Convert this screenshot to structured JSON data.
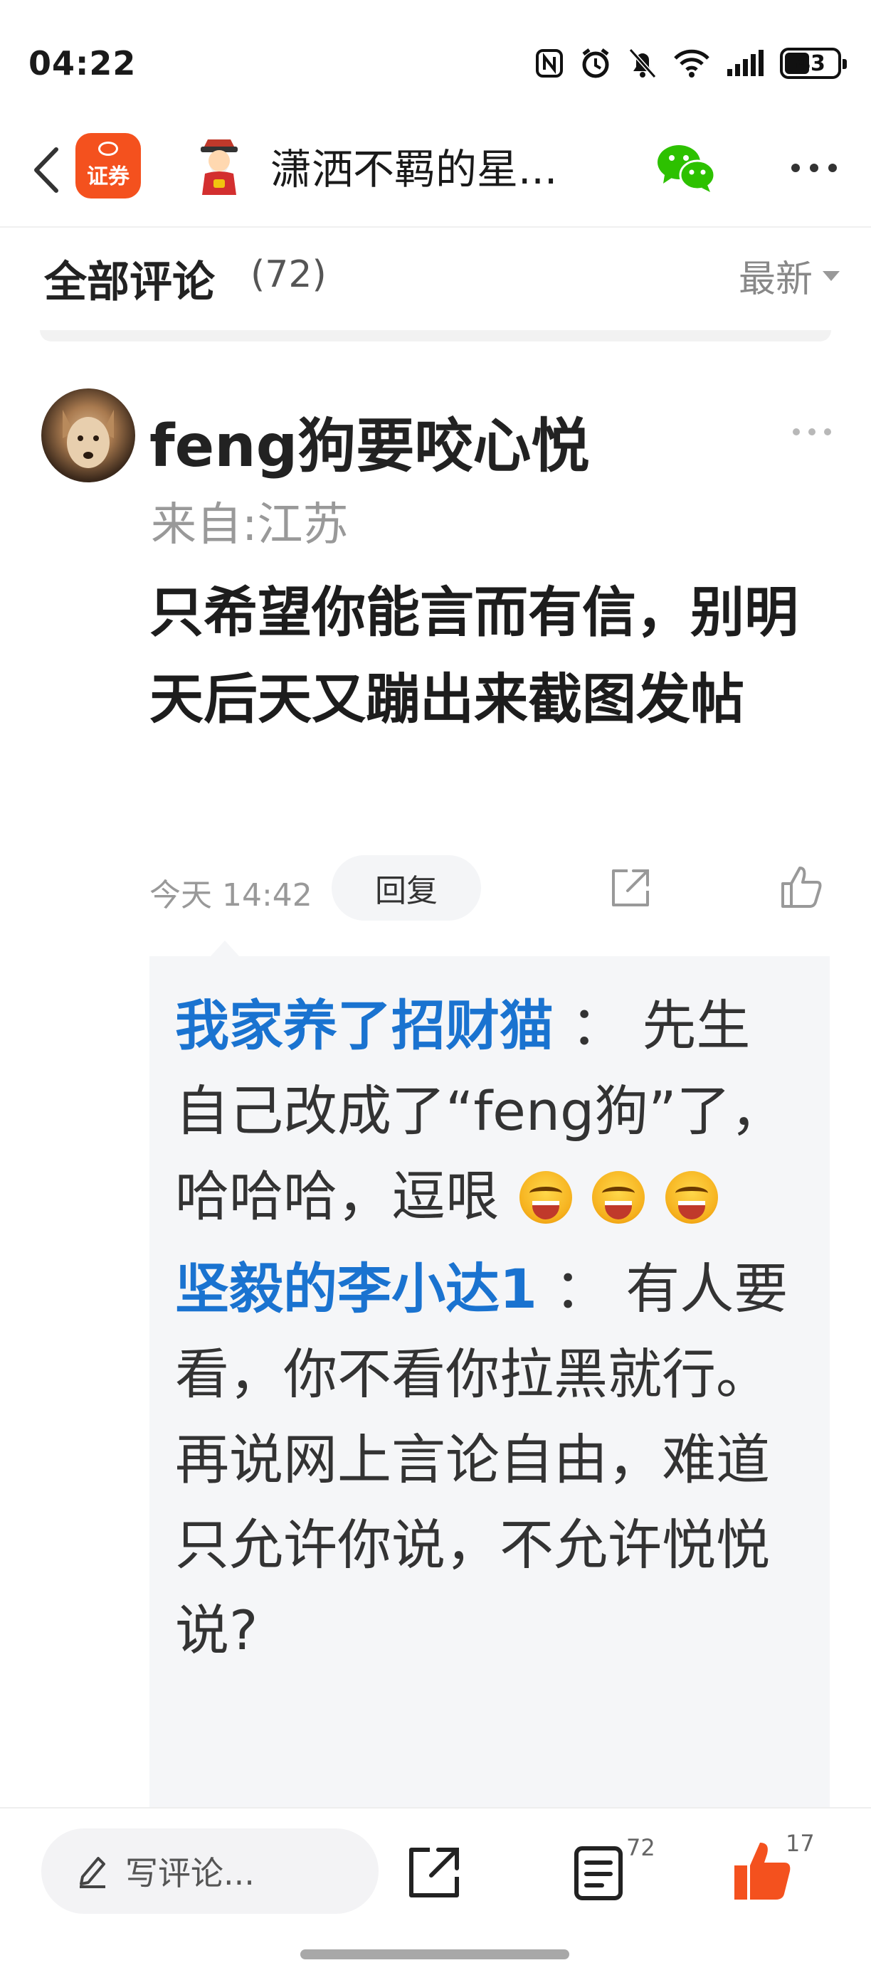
{
  "status_bar": {
    "time": "04:22",
    "battery": 43
  },
  "nav": {
    "app_badge_label": "证券",
    "title": "潇洒不羁的星...",
    "icons": [
      "back-icon",
      "wechat-icon",
      "more-icon"
    ]
  },
  "comments_header": {
    "title": "全部评论",
    "count": "(72)",
    "sort_label": "最新"
  },
  "comment": {
    "author": "feng狗要咬心悦",
    "location": "来自:江苏",
    "body": "只希望你能言而有信，别明天后天又蹦出来截图发帖",
    "time": "今天 14:42",
    "reply_label": "回复"
  },
  "replies": [
    {
      "user": "我家养了招财猫",
      "separator": "：",
      "text": "先生自己改成了“feng狗”了，哈哈哈，逗哏",
      "emoji": [
        "grinning-squint-emoji",
        "grinning-squint-emoji",
        "grinning-squint-emoji"
      ]
    },
    {
      "user": "坚毅的李小达1",
      "separator": "：",
      "text": "有人要看，你不看你拉黑就行。再说网上言论自由，难道只允许你说，不允许悦悦说?"
    }
  ],
  "bottom_bar": {
    "input_placeholder": "写评论...",
    "comment_count": "72",
    "like_count": "17"
  },
  "colors": {
    "accent_orange": "#f4511e",
    "reply_user_blue": "#1a73d0",
    "like_orange": "#f4511e"
  }
}
